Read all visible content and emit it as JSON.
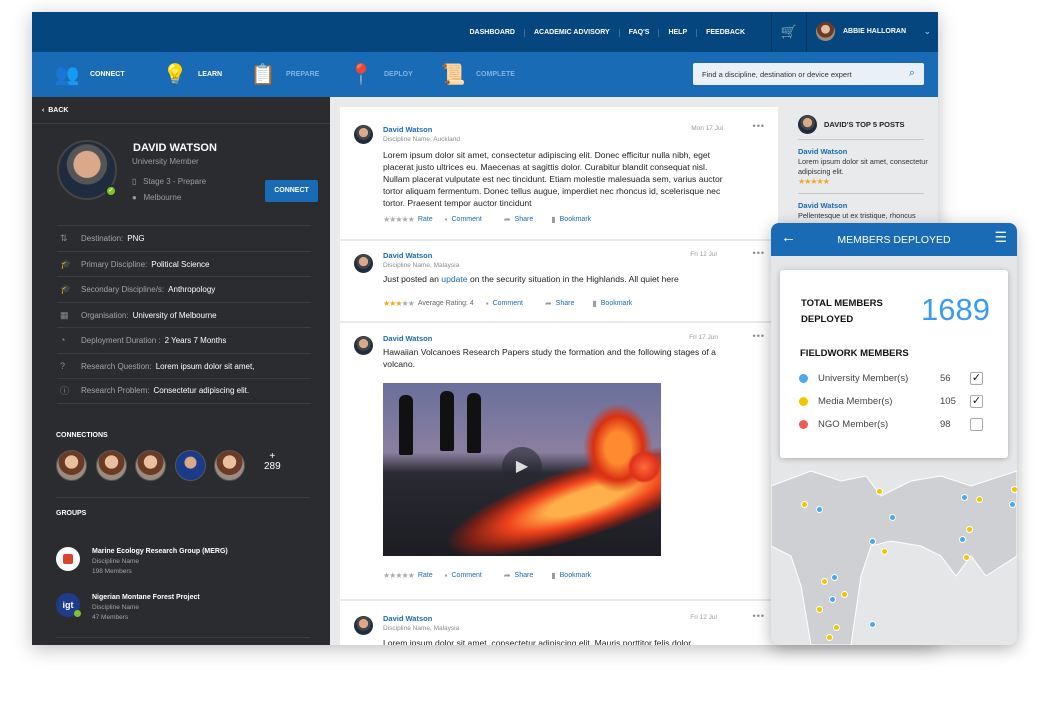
{
  "topbar": {
    "links": [
      "DASHBOARD",
      "ACADEMIC ADVISORY",
      "FAQ'S",
      "HELP",
      "FEEDBACK"
    ],
    "user_name": "ABBIE HALLORAN"
  },
  "steps": [
    {
      "label": "CONNECT",
      "icon": "people-network-icon"
    },
    {
      "label": "LEARN",
      "icon": "lightbulb-icon"
    },
    {
      "label": "PREPARE",
      "icon": "clipboard-check-icon"
    },
    {
      "label": "DEPLOY",
      "icon": "location-user-icon"
    },
    {
      "label": "COMPLETE",
      "icon": "scroll-check-icon"
    }
  ],
  "search": {
    "placeholder": "Find a discipline, destination or device expert"
  },
  "profile": {
    "back": "BACK",
    "name": "DAVID WATSON",
    "role": "University Member",
    "stage": "Stage 3 - Prepare",
    "location": "Melbourne",
    "connect": "CONNECT",
    "fields": [
      {
        "label": "Destination:",
        "value": "PNG"
      },
      {
        "label": "Primary Discipline:",
        "value": "Political Science"
      },
      {
        "label": "Secondary Discipline/s:",
        "value": "Anthropology"
      },
      {
        "label": "Organisation:",
        "value": "University of Melbourne"
      },
      {
        "label": "Deployment Duration :",
        "value": "2 Years  7 Months"
      },
      {
        "label": "Research Question:",
        "value": "Lorem ipsum dolor sit amet,"
      },
      {
        "label": "Research Problem:",
        "value": "Consectetur adipiscing elit."
      }
    ]
  },
  "connections": {
    "title": "CONNECTIONS",
    "more_plus": "+",
    "more_count": "289"
  },
  "groups": {
    "title": "GROUPS",
    "items": [
      {
        "name": "Marine Ecology Research Group (MERG)",
        "discipline": "Discipline Name",
        "members": "198 Members"
      },
      {
        "name": "Nigerian Montane Forest Project",
        "discipline": "Discipline Name",
        "members": "47 Members",
        "logo": "igt"
      }
    ]
  },
  "posts": [
    {
      "author": "David Watson",
      "sub": "Discipline Name, Auckland",
      "date": "Mon 17 Jul",
      "text": "Lorem ipsum dolor sit amet, consectetur adipiscing elit. Donec efficitur nulla nibh, eget placerat justo ultrices eu. Maecenas at sagittis dolor. Curabitur blandit consequat nisl. Nullam placerat vulputate est nec tincidunt. Etiam molestie malesuada sem, varius auctor tortor aliquam fermentum. Donec tellus augue, imperdiet nec rhoncus id, scelerisque nec tortor. Praesent tempor auctor tincidunt",
      "rate": "Rate",
      "comment": "Comment",
      "share": "Share",
      "bookmark": "Bookmark",
      "rating": 0
    },
    {
      "author": "David Watson",
      "sub": "Discipline Name, Malaysia",
      "date": "Fri 12 Jul",
      "text_pre": "Just posted an ",
      "link": "update",
      "text_post": " on the security situation in the Highlands. All quiet here",
      "rating_label": "Average Rating: 4",
      "comment": "Comment",
      "share": "Share",
      "bookmark": "Bookmark",
      "rating": 3
    },
    {
      "author": "David Watson",
      "date": "Fri 17 Jun",
      "text": "Hawaiian Volcanoes Research Papers study the formation and the following stages of a volcano.",
      "rate": "Rate",
      "comment": "Comment",
      "share": "Share",
      "bookmark": "Bookmark",
      "rating": 0
    },
    {
      "author": "David Watson",
      "sub": "Discipline Name, Malaysia",
      "date": "Fri 12 Jul",
      "text": "Lorem ipsum dolor sit amet, consectetur adipiscing elit. Mauris porttitor felis dolor,"
    }
  ],
  "top_posts": {
    "title": "DAVID'S TOP 5 POSTS",
    "items": [
      {
        "author": "David Watson",
        "text": "Lorem ipsum dolor sit amet, consectetur adipiscing elit.",
        "rating": 5
      },
      {
        "author": "David Watson",
        "text": "Pellentesque ut ex tristique, rhoncus"
      }
    ]
  },
  "mobile": {
    "title": "MEMBERS DEPLOYED",
    "total_label": "TOTAL MEMBERS DEPLOYED",
    "total": "1689",
    "fieldwork_title": "FIELDWORK MEMBERS",
    "members": [
      {
        "label": "University Member(s)",
        "count": "56",
        "checked": true,
        "color": "#4aa8ee"
      },
      {
        "label": "Media Member(s)",
        "count": "105",
        "checked": true,
        "color": "#f5c400"
      },
      {
        "label": "NGO Member(s)",
        "count": "98",
        "checked": false,
        "color": "#f25a5a"
      }
    ]
  },
  "colors": {
    "topbar": "#05467e",
    "navbar": "#1a6bb5",
    "sidebar": "#2b2c30",
    "accent": "#1a6bb5",
    "star": "#f5a623"
  }
}
